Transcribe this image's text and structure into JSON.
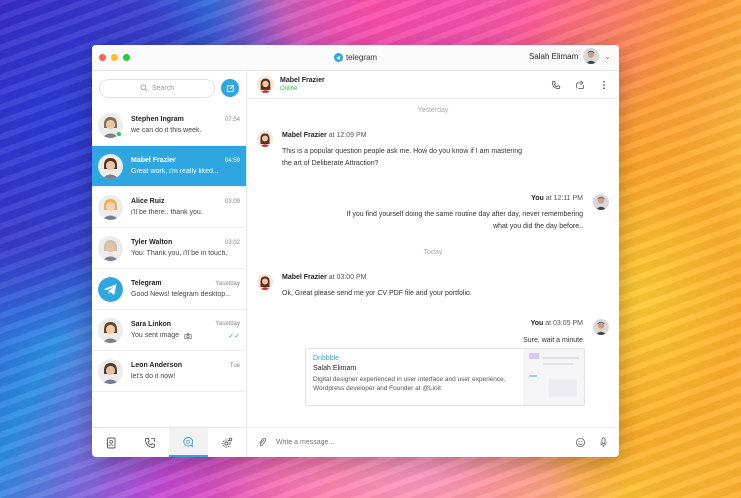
{
  "app": {
    "title": "telegram"
  },
  "user": {
    "name": "Salah Elimam"
  },
  "search": {
    "placeholder": "Search"
  },
  "chats": [
    {
      "name": "Stephen Ingram",
      "time": "07:54",
      "preview": "we can do it this week.",
      "online": true,
      "skin": "#e7c9a9",
      "hair": "#8a6a4a"
    },
    {
      "name": "Mabel Frazier",
      "time": "04:59",
      "preview": "Great work, i'm really liked...",
      "active": true,
      "skin": "#f0c6a8",
      "hair": "#5a2f1c"
    },
    {
      "name": "Alice Ruiz",
      "time": "03:09",
      "preview": "i'll be there.. thank you.",
      "skin": "#f6d2b4",
      "hair": "#e2b45a"
    },
    {
      "name": "Tyler Walton",
      "time": "03:02",
      "preview": "You: Thank you, i'll be in touch.",
      "skin": "#e9c2a0",
      "hair": "#c9c0b6"
    },
    {
      "name": "Telegram",
      "time": "Yasetday",
      "preview": "Good News! telegram desktop...",
      "telegram": true
    },
    {
      "name": "Sara Linkon",
      "time": "Yasetday",
      "preview": "You sent image",
      "camera": true,
      "read": true,
      "skin": "#f2cdb0",
      "hair": "#6b4426"
    },
    {
      "name": "Leon Anderson",
      "time": "Tue",
      "preview": "let's do it now!",
      "skin": "#e6c0a0",
      "hair": "#4a3a30"
    }
  ],
  "conversation": {
    "name": "Mabel Frazier",
    "status": "Online",
    "day_yesterday": "Yesterday",
    "day_today": "Today",
    "messages": [
      {
        "from": "Mabel Frazier",
        "at": "at 12:09 PM",
        "text1": "This is a popular question people ask me. How do you know if I am mastering",
        "text2": "the art of Deliberate Attraction?"
      },
      {
        "from": "You",
        "at": "at 12:11 PM",
        "text1": "If you find yourself doing the same routine day after day, never remembering",
        "text2": "what you did the day before.."
      },
      {
        "from": "Mabel Frazier",
        "at": "at 03:00 PM",
        "text1": "Ok, Great please send me yor CV PDF file and your portfolio."
      },
      {
        "from": "You",
        "at": "at 03:05 PM",
        "text1": "Sure. wait a minute"
      }
    ],
    "link_card": {
      "source": "Dribbble",
      "title": "Salah Elimam",
      "desc": "Digital designer experienced in user interface and user experience, Wordpress developer and Founder at @Lioit"
    }
  },
  "composer": {
    "placeholder": "Write a message..."
  },
  "colors": {
    "accent": "#2ea6df",
    "online": "#28c840"
  }
}
